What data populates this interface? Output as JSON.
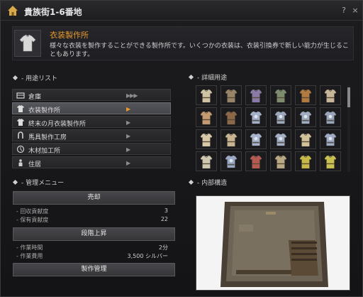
{
  "window": {
    "title": "貴族街1-6番地",
    "help": "?",
    "close": "×"
  },
  "header": {
    "name": "衣装製作所",
    "description": "様々な衣装を製作することができる製作所です。いくつかの衣装は、衣装引換券で新しい能力が生じることもあります。"
  },
  "usage": {
    "label": "- 用途リスト",
    "items": [
      {
        "label": "倉庫",
        "icon": "box-icon",
        "level": 3,
        "selected": false
      },
      {
        "label": "衣装製作所",
        "icon": "shirt-icon",
        "level": 1,
        "selected": true
      },
      {
        "label": "終末の月衣装製作所",
        "icon": "shirt-icon",
        "level": 1,
        "selected": false
      },
      {
        "label": "馬具製作工房",
        "icon": "horseshoe-icon",
        "level": 1,
        "selected": false
      },
      {
        "label": "木材加工所",
        "icon": "saw-icon",
        "level": 1,
        "selected": false
      },
      {
        "label": "住居",
        "icon": "person-icon",
        "level": 1,
        "selected": false
      }
    ]
  },
  "management": {
    "label": "- 管理メニュー",
    "sell_label": "売却",
    "recovery_label": "- 回収貢献度",
    "recovery_value": "3",
    "owned_label": "- 保有貢献度",
    "owned_value": "22",
    "upgrade_label": "段階上昇",
    "work_time_label": "- 作業時間",
    "work_time_value": "2分",
    "work_cost_label": "- 作業費用",
    "work_cost_value": "3,500 シルバー",
    "craft_label": "製作管理"
  },
  "detail": {
    "label": "- 詳細用途",
    "items": [
      {
        "icon": "tunic-icon",
        "color": "#cfc3a3"
      },
      {
        "icon": "tunic-icon",
        "color": "#9a8468"
      },
      {
        "icon": "tunic-icon",
        "color": "#8a7aa8"
      },
      {
        "icon": "tunic-icon",
        "color": "#7c8c6c"
      },
      {
        "icon": "tunic-icon",
        "color": "#b07a40"
      },
      {
        "icon": "tunic-icon",
        "color": "#c8b698"
      },
      {
        "icon": "tunic-icon",
        "color": "#c49a70"
      },
      {
        "icon": "tunic-icon",
        "color": "#8c6848"
      },
      {
        "icon": "armor-icon",
        "color": "#a4b0c8"
      },
      {
        "icon": "armor-icon",
        "color": "#9ca8bc"
      },
      {
        "icon": "armor-icon",
        "color": "#a0acc0"
      },
      {
        "icon": "armor-icon",
        "color": "#98a4b8"
      },
      {
        "icon": "tunic-icon",
        "color": "#d8caa8"
      },
      {
        "icon": "tunic-icon",
        "color": "#c8b490"
      },
      {
        "icon": "armor-icon",
        "color": "#a8b4cc"
      },
      {
        "icon": "armor-icon",
        "color": "#a4b0c4"
      },
      {
        "icon": "tunic-icon",
        "color": "#d2c29a"
      },
      {
        "icon": "armor-icon",
        "color": "#a0acc4"
      },
      {
        "icon": "tunic-icon",
        "color": "#cfc8b0"
      },
      {
        "icon": "armor-icon",
        "color": "#9aa8c4"
      },
      {
        "icon": "tunic-icon",
        "color": "#b45a50"
      },
      {
        "icon": "tunic-icon",
        "color": "#b8a884"
      },
      {
        "icon": "tunic-icon",
        "color": "#c8b848"
      },
      {
        "icon": "tunic-icon",
        "color": "#c8c050"
      }
    ]
  },
  "interior": {
    "label": "- 内部構造"
  }
}
